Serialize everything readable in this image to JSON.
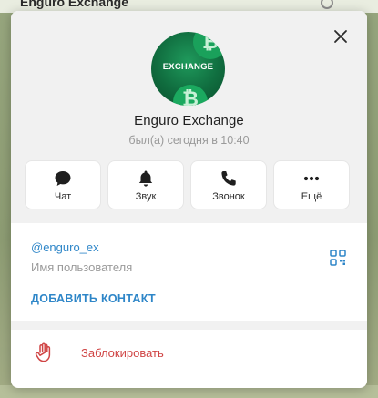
{
  "background": {
    "chat_title": "Enguro Exchange"
  },
  "profile": {
    "avatar": {
      "logo_text": "EXCHANGE"
    },
    "name": "Enguro Exchange",
    "status": "был(а) сегодня в 10:40",
    "colors": {
      "link": "#2e86c8",
      "danger": "#d04545",
      "avatar_green": "#106d3f"
    }
  },
  "actions": [
    {
      "label": "Чат",
      "icon": "chat-bubble-icon"
    },
    {
      "label": "Звук",
      "icon": "bell-icon"
    },
    {
      "label": "Звонок",
      "icon": "phone-icon"
    },
    {
      "label": "Ещё",
      "icon": "more-dots-icon"
    }
  ],
  "info": {
    "username": "@enguro_ex",
    "username_caption": "Имя пользователя",
    "qr_icon": "qr-code-icon",
    "add_contact": "ДОБАВИТЬ КОНТАКТ"
  },
  "block": {
    "label": "Заблокировать",
    "icon": "hand-stop-icon"
  }
}
